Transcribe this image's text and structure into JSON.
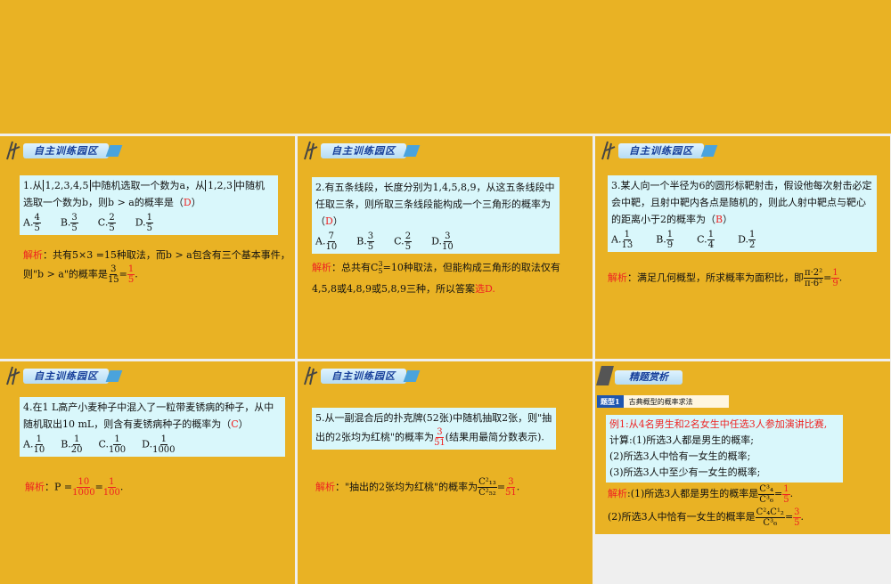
{
  "slides": {
    "header_label": "自主训练园区",
    "s1": {
      "question_a": "1.从",
      "set1": "1,2,3,4,5",
      "question_b": "中随机选取一个数为a，从",
      "set2": "1,2,3",
      "question_c": "中随机选取一个数为b，则b > a的概率是（",
      "answer": "D",
      "question_end": "）",
      "options": [
        {
          "label": "A.",
          "n": "4",
          "d": "5"
        },
        {
          "label": "B.",
          "n": "3",
          "d": "5"
        },
        {
          "label": "C.",
          "n": "2",
          "d": "5"
        },
        {
          "label": "D.",
          "n": "1",
          "d": "5"
        }
      ],
      "sol_label": "解析",
      "sol_line1": "：共有5×3 =15种取法，而b > a包含有三个基本事件，",
      "sol_line2": "则\"b > a\"的概率是",
      "sol_frac": {
        "n": "3",
        "d": "15"
      },
      "sol_eq": "=",
      "sol_res": {
        "n": "1",
        "d": "5"
      }
    },
    "s2": {
      "question": "2.有五条线段，长度分别为1,4,5,8,9，从这五条线段中任取三条，则所取三条线段能构成一个三角形的概率为（",
      "answer": "D",
      "question_end": "）",
      "options": [
        {
          "label": "A.",
          "n": "7",
          "d": "10"
        },
        {
          "label": "B.",
          "n": "3",
          "d": "5"
        },
        {
          "label": "C.",
          "n": "2",
          "d": "5"
        },
        {
          "label": "D.",
          "n": "3",
          "d": "10"
        }
      ],
      "sol_label": "解析",
      "sol_line1": "：总共有C",
      "sol_line1b": "=10种取法，但能构成三角形的取法仅有",
      "sol_line2": "4,5,8或4,8,9或5,8,9三种，所以答案",
      "sol_ans": "选D."
    },
    "s3": {
      "question": "3.某人向一个半径为6的圆形标靶射击，假设他每次射击必定会中靶，且射中靶内各点是随机的，则此人射中靶点与靶心的距离小于2的概率为（",
      "answer": "B",
      "question_end": "）",
      "options": [
        {
          "label": "A.",
          "n": "1",
          "d": "13"
        },
        {
          "label": "B.",
          "n": "1",
          "d": "9"
        },
        {
          "label": "C.",
          "n": "1",
          "d": "4"
        },
        {
          "label": "D.",
          "n": "1",
          "d": "2"
        }
      ],
      "sol_label": "解析",
      "sol_line1": "：满足几何概型，所求概率为面积比，即",
      "sol_frac": {
        "n": "π·2²",
        "d": "π·6²"
      },
      "sol_eq": "=",
      "sol_res": {
        "n": "1",
        "d": "9"
      }
    },
    "s4": {
      "question": "4.在1 L高产小麦种子中混入了一粒带麦锈病的种子，从中随机取出10 mL，则含有麦锈病种子的概率为（",
      "answer": "C",
      "question_end": "）",
      "options": [
        {
          "label": "A.",
          "n": "1",
          "d": "10"
        },
        {
          "label": "B.",
          "n": "1",
          "d": "20"
        },
        {
          "label": "C.",
          "n": "1",
          "d": "100"
        },
        {
          "label": "D.",
          "n": "1",
          "d": "1000"
        }
      ],
      "sol_label": "解析",
      "sol_p": "：P =",
      "sol_frac": {
        "n": "10",
        "d": "1000"
      },
      "sol_eq": "=",
      "sol_res": {
        "n": "1",
        "d": "100"
      }
    },
    "s5": {
      "question_a": "5.从一副混合后的扑克牌(52张)中随机抽取2张，则\"抽出的2张均为红桃\"的概率为",
      "blank": {
        "n": "3",
        "d": "51"
      },
      "question_b": "(结果用最简分数表示).",
      "sol_label": "解析",
      "sol_line": "：\"抽出的2张均为红桃\"的概率为",
      "sol_frac": {
        "n": "C²₁₃",
        "d": "C²₅₂"
      },
      "sol_eq": "=",
      "sol_res": {
        "n": "3",
        "d": "51"
      }
    },
    "s6": {
      "header_label": "精题赏析",
      "type_tag": "题型1",
      "type_text": "古典概型的概率求法",
      "example": "例1:从4名男生和2名女生中任选3人参加演讲比赛,",
      "ask0": "计算:(1)所选3人都是男生的概率;",
      "ask1": "(2)所选3人中恰有一女生的概率;",
      "ask2": "(3)所选3人中至少有一女生的概率;",
      "sol_label": "解析",
      "sol1": ":(1)所选3人都是男生的概率是",
      "sol1_frac": {
        "n": "C³₄",
        "d": "C³₆"
      },
      "sol1_res": {
        "n": "1",
        "d": "5"
      },
      "sol2": "(2)所选3人中恰有一女生的概率是",
      "sol2_frac": {
        "n": "C²₄C¹₂",
        "d": "C³₆"
      },
      "sol2_res": {
        "n": "3",
        "d": "5"
      }
    }
  }
}
